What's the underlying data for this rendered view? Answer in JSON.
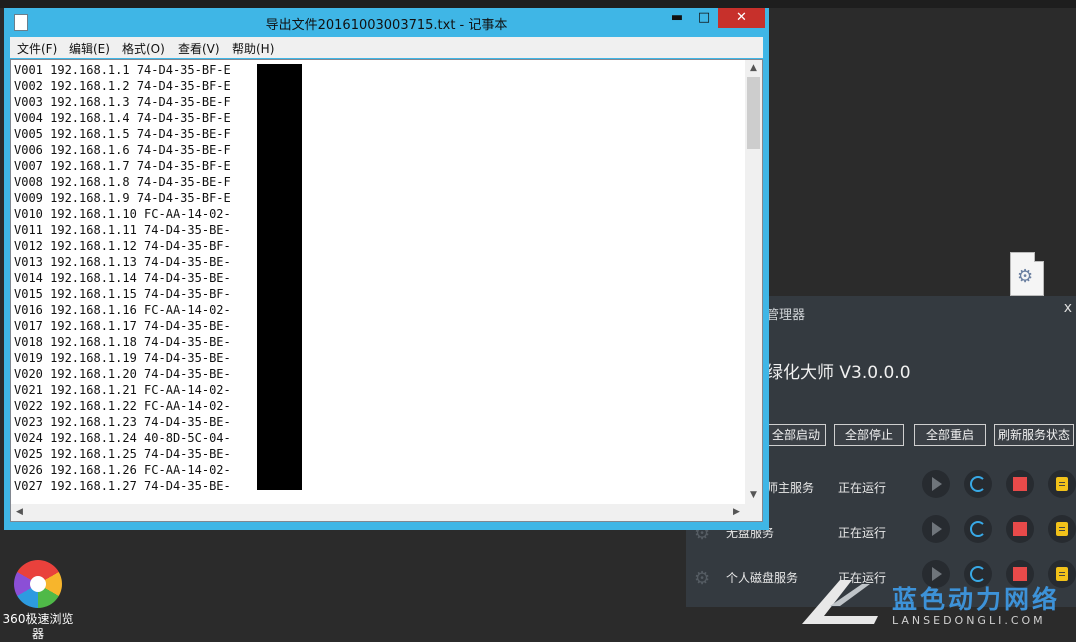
{
  "notepad": {
    "title": "导出文件20161003003715.txt - 记事本",
    "controls": {
      "minimize": "▬",
      "maximize": "□",
      "close": "✕"
    },
    "menu": [
      "文件(F)",
      "编辑(E)",
      "格式(O)",
      "查看(V)",
      "帮助(H)"
    ],
    "lines": [
      "V001 192.168.1.1 74-D4-35-BF-E",
      "V002 192.168.1.2 74-D4-35-BF-E",
      "V003 192.168.1.3 74-D4-35-BE-F",
      "V004 192.168.1.4 74-D4-35-BF-E",
      "V005 192.168.1.5 74-D4-35-BE-F",
      "V006 192.168.1.6 74-D4-35-BE-F",
      "V007 192.168.1.7 74-D4-35-BF-E",
      "V008 192.168.1.8 74-D4-35-BE-F",
      "V009 192.168.1.9 74-D4-35-BF-E",
      "V010 192.168.1.10 FC-AA-14-02-",
      "V011 192.168.1.11 74-D4-35-BE-",
      "V012 192.168.1.12 74-D4-35-BF-",
      "V013 192.168.1.13 74-D4-35-BE-",
      "V014 192.168.1.14 74-D4-35-BE-",
      "V015 192.168.1.15 74-D4-35-BF-",
      "V016 192.168.1.16 FC-AA-14-02-",
      "V017 192.168.1.17 74-D4-35-BE-",
      "V018 192.168.1.18 74-D4-35-BE-",
      "V019 192.168.1.19 74-D4-35-BE-",
      "V020 192.168.1.20 74-D4-35-BE-",
      "V021 192.168.1.21 FC-AA-14-02-",
      "V022 192.168.1.22 FC-AA-14-02-",
      "V023 192.168.1.23 74-D4-35-BE-",
      "V024 192.168.1.24 40-8D-5C-04-",
      "V025 192.168.1.25 74-D4-35-BE-",
      "V026 192.168.1.26 FC-AA-14-02-",
      "V027 192.168.1.27 74-D4-35-BE-"
    ]
  },
  "service_manager": {
    "title_partial": "管理器",
    "close": "x",
    "app_name_partial": "绿化大师  V3.0.0.0",
    "buttons": [
      "全部启动",
      "全部停止",
      "全部重启",
      "刷新服务状态"
    ],
    "services": [
      {
        "name": "师主服务",
        "status": "正在运行"
      },
      {
        "name": "无盘服务",
        "status": "正在运行"
      },
      {
        "name": "个人磁盘服务",
        "status": "正在运行"
      }
    ],
    "colors": {
      "bg": "#343a40",
      "stop": "#e84a4a",
      "refresh": "#38a9e6",
      "note": "#f2c21a"
    }
  },
  "desktop": {
    "browser_label": "360极速浏览器"
  },
  "watermark": {
    "cn": "蓝色动力网络",
    "en": "LANSEDONGLI.COM"
  }
}
